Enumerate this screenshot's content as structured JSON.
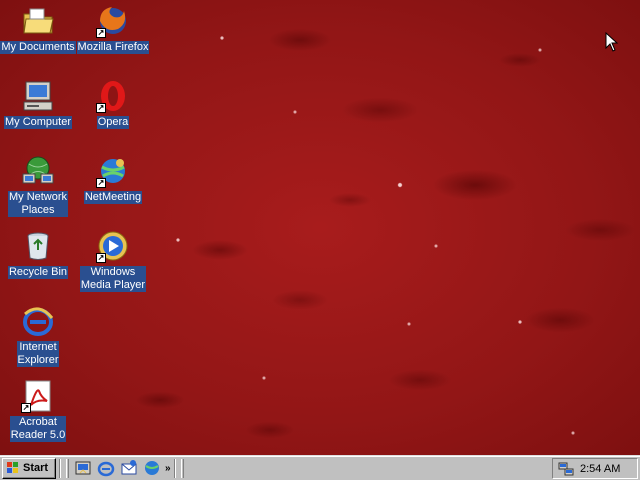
{
  "desktop": {
    "icons": [
      {
        "label": "My Documents",
        "icon": "folder-icon"
      },
      {
        "label": "Mozilla Firefox",
        "icon": "firefox-icon",
        "shortcut": true
      },
      {
        "label": "My Computer",
        "icon": "computer-icon"
      },
      {
        "label": "Opera",
        "icon": "opera-icon",
        "shortcut": true
      },
      {
        "label": "My Network\nPlaces",
        "icon": "network-icon"
      },
      {
        "label": "NetMeeting",
        "icon": "netmeeting-icon",
        "shortcut": true
      },
      {
        "label": "Recycle Bin",
        "icon": "recycle-bin-icon"
      },
      {
        "label": "Windows\nMedia Player",
        "icon": "media-player-icon",
        "shortcut": true
      },
      {
        "label": "Internet\nExplorer",
        "icon": "internet-explorer-icon"
      },
      {
        "label": "Acrobat\nReader 5.0",
        "icon": "acrobat-icon",
        "shortcut": true
      }
    ]
  },
  "taskbar": {
    "start_label": "Start",
    "quick_launch": [
      "show-desktop-icon",
      "internet-explorer-icon",
      "outlook-express-icon",
      "netmeeting-icon"
    ],
    "chevron": "»",
    "clock": "2:54 AM"
  },
  "colors": {
    "wallpaper": "#921616",
    "label_bg": "#2a4f90",
    "taskbar": "#c0c0c0"
  }
}
